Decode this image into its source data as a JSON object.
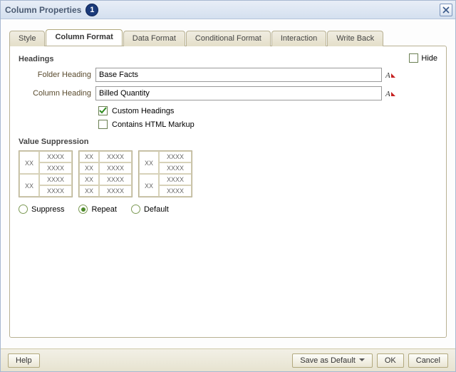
{
  "title": "Column Properties",
  "badge": "1",
  "tabs": [
    {
      "label": "Style",
      "active": false
    },
    {
      "label": "Column Format",
      "active": true
    },
    {
      "label": "Data Format",
      "active": false
    },
    {
      "label": "Conditional Format",
      "active": false
    },
    {
      "label": "Interaction",
      "active": false
    },
    {
      "label": "Write Back",
      "active": false
    }
  ],
  "headings": {
    "section_label": "Headings",
    "hide_label": "Hide",
    "hide_checked": false,
    "folder_label": "Folder Heading",
    "folder_value": "Base Facts",
    "column_label": "Column Heading",
    "column_value": "Billed Quantity",
    "custom_headings_label": "Custom Headings",
    "custom_headings_checked": true,
    "contains_html_label": "Contains HTML Markup",
    "contains_html_checked": false
  },
  "value_suppression": {
    "section_label": "Value Suppression",
    "xx": "XX",
    "xxxx": "XXXX",
    "radios": {
      "suppress": "Suppress",
      "repeat": "Repeat",
      "default": "Default",
      "selected": "repeat"
    }
  },
  "footer": {
    "help": "Help",
    "save_default": "Save as Default",
    "ok": "OK",
    "cancel": "Cancel"
  }
}
